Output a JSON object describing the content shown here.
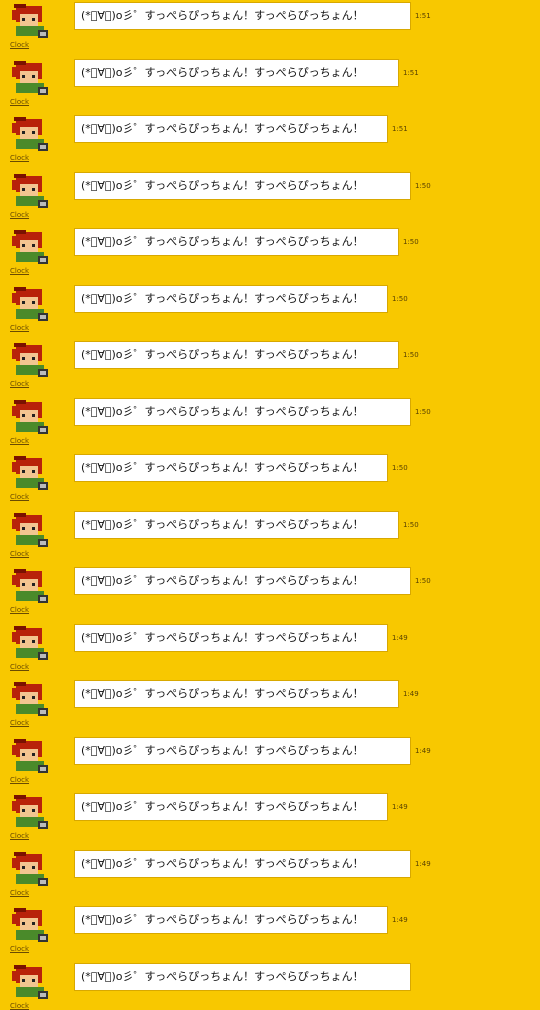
{
  "user": "Clock",
  "message": "(*ﾟ∀ﾟ)o彡゜すっぺらぴっちょん！すっぺらぴっちょん！",
  "times": [
    "1:51",
    "1:51",
    "1:51",
    "1:50",
    "1:50",
    "1:50",
    "1:50",
    "1:50",
    "1:50",
    "1:50",
    "1:50",
    "1:49",
    "1:49",
    "1:49",
    "1:49",
    "1:49",
    "1:49",
    ""
  ],
  "avatar_colors": {
    "hair": "#b8220a",
    "skin": "#f3c590",
    "shirt": "#4a8a2a",
    "shadow": "#7a1200"
  }
}
